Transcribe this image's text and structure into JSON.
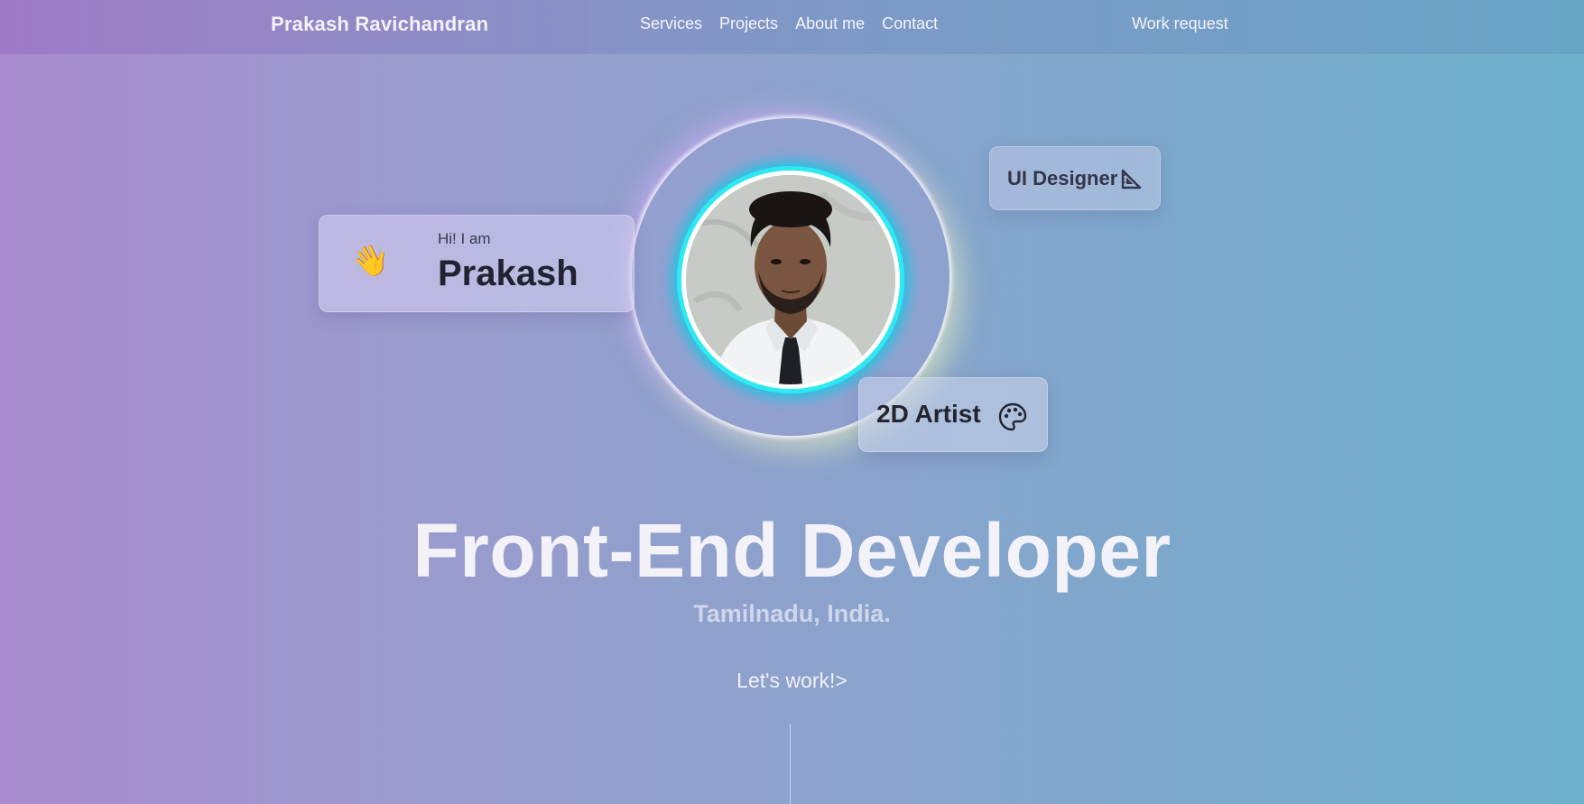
{
  "nav": {
    "brand": "Prakash Ravichandran",
    "links": [
      "Services",
      "Projects",
      "About me",
      "Contact"
    ],
    "work_request": "Work request"
  },
  "hero": {
    "greeting_small": "Hi! I am",
    "greeting_name": "Prakash",
    "wave_emoji": "👋",
    "badge_ui": "UI Designer",
    "badge_ui_icon": "triangle-ruler-icon",
    "badge_2d": "2D Artist",
    "badge_2d_icon": "palette-icon",
    "title": "Front-End Developer",
    "location": "Tamilnadu, India.",
    "cta": "Let's work!>"
  },
  "colors": {
    "accent_ring": "#2ee8f2",
    "gradient_start": "#a98ccf",
    "gradient_end": "#6cb0cc"
  }
}
